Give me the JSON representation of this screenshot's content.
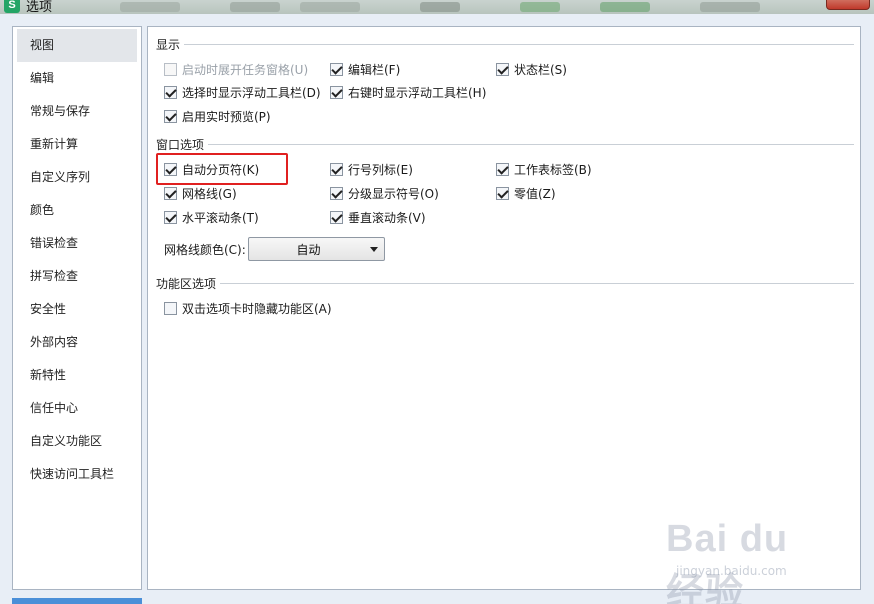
{
  "window": {
    "title": "选项",
    "icon": "wps-spreadsheet-icon"
  },
  "nav": {
    "items": [
      {
        "label": "视图",
        "selected": true
      },
      {
        "label": "编辑"
      },
      {
        "label": "常规与保存"
      },
      {
        "label": "重新计算"
      },
      {
        "label": "自定义序列"
      },
      {
        "label": "颜色"
      },
      {
        "label": "错误检查"
      },
      {
        "label": "拼写检查"
      },
      {
        "label": "安全性"
      },
      {
        "label": "外部内容"
      },
      {
        "label": "新特性"
      },
      {
        "label": "信任中心"
      },
      {
        "label": "自定义功能区"
      },
      {
        "label": "快速访问工具栏"
      }
    ]
  },
  "display": {
    "title": "显示",
    "opts": {
      "show_taskpane": {
        "label": "启动时展开任务窗格(U)",
        "checked": false,
        "disabled": true
      },
      "edit_bar": {
        "label": "编辑栏(F)",
        "checked": true
      },
      "status_bar": {
        "label": "状态栏(S)",
        "checked": true
      },
      "float_toolbar_select": {
        "label": "选择时显示浮动工具栏(D)",
        "checked": true
      },
      "float_toolbar_rightclick": {
        "label": "右键时显示浮动工具栏(H)",
        "checked": true
      },
      "live_preview": {
        "label": "启用实时预览(P)",
        "checked": true
      }
    }
  },
  "window_options": {
    "title": "窗口选项",
    "opts": {
      "auto_page_break": {
        "label": "自动分页符(K)",
        "checked": true
      },
      "row_col_headers": {
        "label": "行号列标(E)",
        "checked": true
      },
      "sheet_tabs": {
        "label": "工作表标签(B)",
        "checked": true
      },
      "gridlines": {
        "label": "网格线(G)",
        "checked": true
      },
      "outline_symbols": {
        "label": "分级显示符号(O)",
        "checked": true
      },
      "zero_values": {
        "label": "零值(Z)",
        "checked": true
      },
      "h_scrollbar": {
        "label": "水平滚动条(T)",
        "checked": true
      },
      "v_scrollbar": {
        "label": "垂直滚动条(V)",
        "checked": true
      }
    },
    "grid_color_label": "网格线颜色(C):",
    "grid_color_value": "自动"
  },
  "ribbon": {
    "title": "功能区选项",
    "opts": {
      "dblclick_hide": {
        "label": "双击选项卡时隐藏功能区(A)",
        "checked": false
      }
    }
  },
  "watermark": {
    "logo": "Bai du 经验",
    "sub": "jingyan.baidu.com"
  }
}
